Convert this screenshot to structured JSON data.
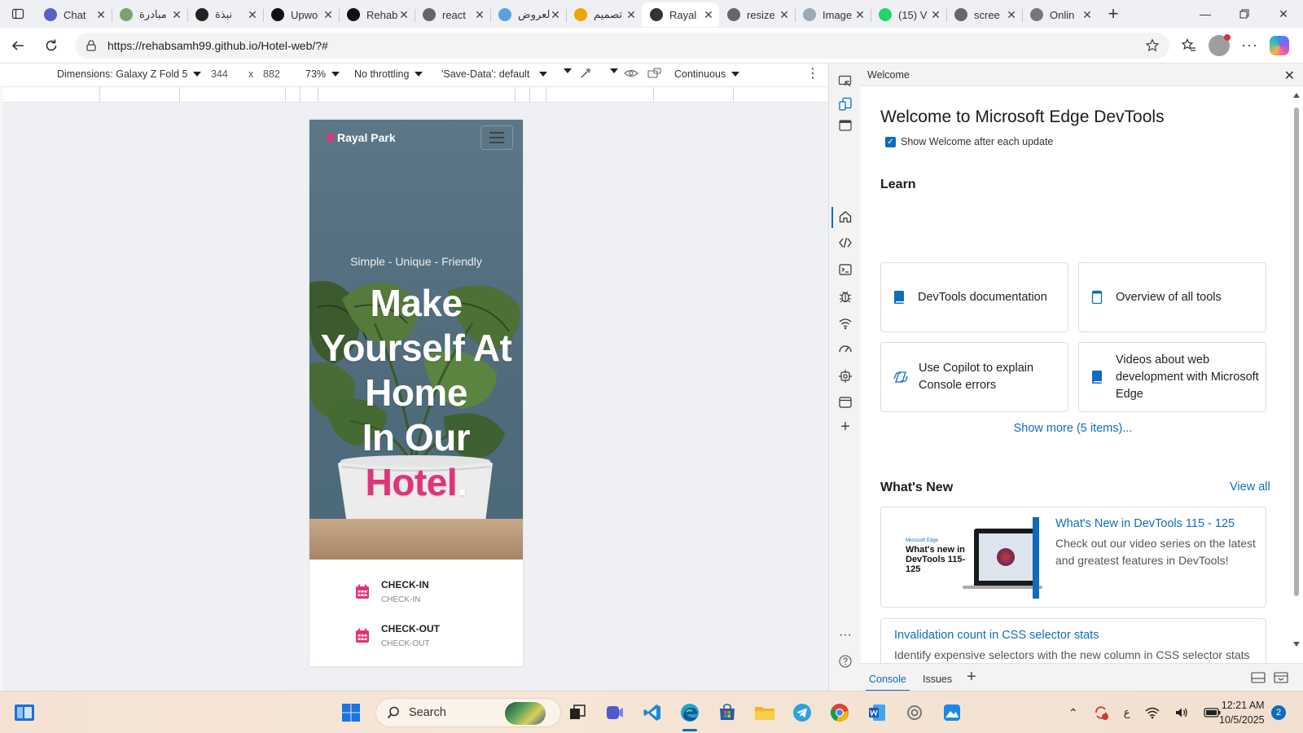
{
  "browser": {
    "tabs": [
      {
        "title": "Chat",
        "icon": "teams-icon",
        "color": "#5b5fc7",
        "active": false
      },
      {
        "title": "مبادرة",
        "icon": "leaf-icon",
        "color": "#7aa36b",
        "active": false
      },
      {
        "title": "نبذة",
        "icon": "openai-icon",
        "color": "#222222",
        "active": false
      },
      {
        "title": "Upwo",
        "icon": "upwork-icon",
        "color": "#111111",
        "active": false
      },
      {
        "title": "Rehab",
        "icon": "upwork-icon",
        "color": "#111111",
        "active": false
      },
      {
        "title": "react",
        "icon": "search-icon",
        "color": "#666666",
        "active": false
      },
      {
        "title": "العروض",
        "icon": "circle-icon",
        "color": "#5aa0e0",
        "active": false
      },
      {
        "title": "تصميم",
        "icon": "number-five-icon",
        "color": "#f0a500",
        "active": false
      },
      {
        "title": "Rayal",
        "icon": "globe-icon",
        "color": "#333333",
        "active": true
      },
      {
        "title": "resize",
        "icon": "search-icon",
        "color": "#666666",
        "active": false
      },
      {
        "title": "Image",
        "icon": "image-icon",
        "color": "#9ab",
        "active": false
      },
      {
        "title": "(15) V",
        "icon": "whatsapp-icon",
        "color": "#25d366",
        "active": false
      },
      {
        "title": "scree",
        "icon": "search-icon",
        "color": "#666666",
        "active": false
      },
      {
        "title": "Onlin",
        "icon": "circle-icon",
        "color": "#777777",
        "active": false
      }
    ],
    "url": "https://rehabsamh99.github.io/Hotel-web/?#"
  },
  "device_toolbar": {
    "dimensions": "Dimensions: Galaxy Z Fold 5",
    "width": "344",
    "times": "x",
    "height": "882",
    "zoom": "73%",
    "throttling": "No throttling",
    "save_data": "'Save-Data': default",
    "mode": "Continuous"
  },
  "site": {
    "brand": "Rayal Park",
    "tagline": "Simple - Unique - Friendly",
    "headline_lines": [
      "Make",
      "Yourself At",
      "Home",
      "In Our"
    ],
    "headline_accent": "Hotel",
    "headline_dot": ".",
    "checkin_title": "CHECK-IN",
    "checkin_sub": "CHECK-IN",
    "checkout_title": "CHECK-OUT",
    "checkout_sub": "CHECK-OUT",
    "accent_color": "#e0337a"
  },
  "devtools": {
    "header": "Welcome",
    "title": "Welcome to Microsoft Edge DevTools",
    "show_welcome": "Show Welcome after each update",
    "learn": "Learn",
    "cards": [
      "DevTools documentation",
      "Overview of all tools",
      "Use Copilot to explain Console errors",
      "Videos about web development with Microsoft Edge"
    ],
    "show_more": "Show more (5 items)...",
    "whats_new": "What's New",
    "view_all": "View all",
    "news": [
      {
        "title": "What's New in DevTools 115 - 125",
        "desc": "Check out our video series on the latest and greatest features in DevTools!",
        "thumb_brand": "Microsoft Edge",
        "thumb_text": "What's new in DevTools 115-125"
      },
      {
        "title": "Invalidation count in CSS selector stats",
        "desc": "Identify expensive selectors with the new column in CSS selector stats (Performance tool) to reduce costly style recalculations."
      }
    ],
    "bottom_tabs": [
      "Console",
      "Issues"
    ]
  },
  "taskbar": {
    "search": "Search",
    "lang": "ع",
    "time": "12:21 AM",
    "date": "10/5/2025",
    "notifications": "2"
  }
}
